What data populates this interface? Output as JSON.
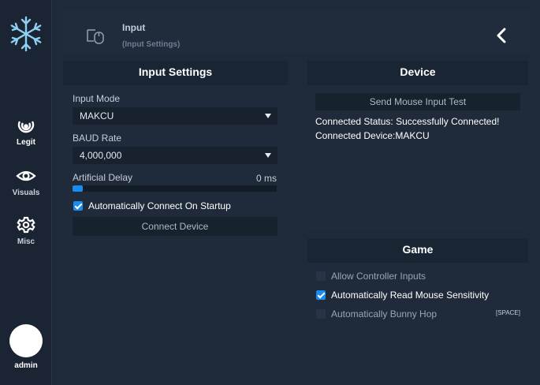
{
  "sidebar": {
    "items": [
      {
        "label": "Legit",
        "icon": "target-icon"
      },
      {
        "label": "Visuals",
        "icon": "eye-icon"
      },
      {
        "label": "Misc",
        "icon": "gear-icon"
      }
    ],
    "user": "admin"
  },
  "header": {
    "title": "Input",
    "subtitle": "(Input Settings)"
  },
  "input_settings": {
    "title": "Input Settings",
    "input_mode_label": "Input Mode",
    "input_mode_value": "MAKCU",
    "baud_label": "BAUD Rate",
    "baud_value": "4,000,000",
    "delay_label": "Artificial Delay",
    "delay_value": "0 ms",
    "delay_fraction": 0.0,
    "auto_connect_label": "Automatically Connect On Startup",
    "auto_connect_checked": true,
    "connect_button": "Connect Device"
  },
  "device": {
    "title": "Device",
    "test_button": "Send Mouse Input Test",
    "status_line": "Connected Status: Successfully Connected!",
    "device_line": "Connected Device:MAKCU"
  },
  "game": {
    "title": "Game",
    "options": [
      {
        "label": "Allow Controller Inputs",
        "checked": false
      },
      {
        "label": "Automatically Read Mouse Sensitivity",
        "checked": true
      },
      {
        "label": "Automatically Bunny Hop",
        "checked": false
      }
    ],
    "bhop_key": "[SPACE]"
  },
  "colors": {
    "accent": "#1a8cf0",
    "background": "#1e2a3a",
    "panel": "#1f2b3b"
  }
}
